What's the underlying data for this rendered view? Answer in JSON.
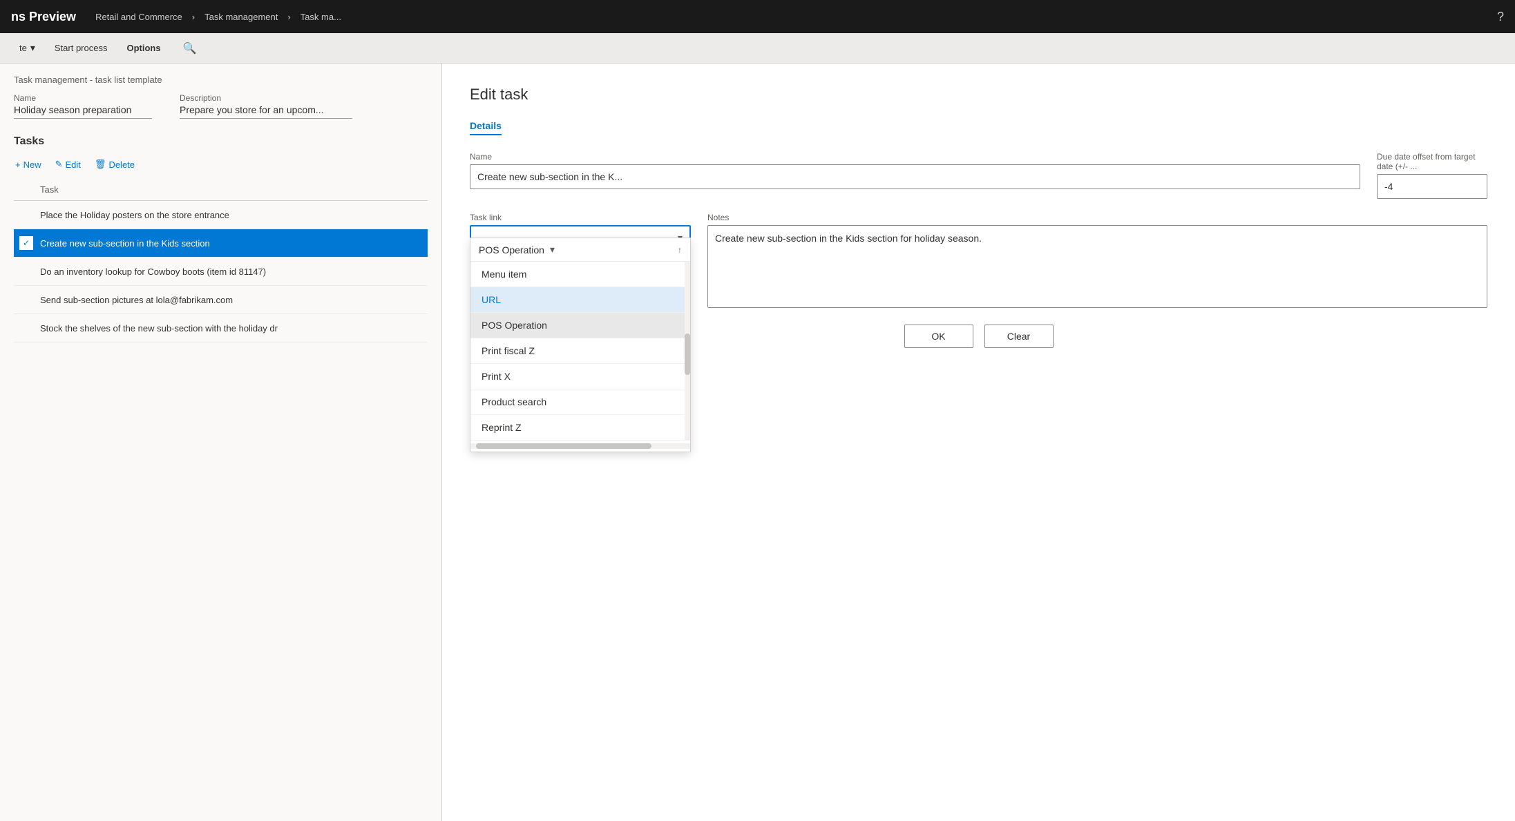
{
  "topNav": {
    "appTitle": "ns Preview",
    "breadcrumbs": [
      "Retail and Commerce",
      "Task management",
      "Task ma..."
    ],
    "helpIcon": "?"
  },
  "toolbar": {
    "deleteLabel": "te",
    "startProcessLabel": "Start process",
    "optionsLabel": "Options",
    "searchIcon": "🔍"
  },
  "leftPanel": {
    "pageTitle": "Task management - task list template",
    "nameLabel": "Name",
    "descriptionLabel": "Description",
    "nameValue": "Holiday season preparation",
    "descriptionValue": "Prepare you store for an upcom...",
    "tasksTitle": "Tasks",
    "newLabel": "+ New",
    "editLabel": "✎ Edit",
    "deleteLabel": "🗑 Delete",
    "taskColHeader": "Task",
    "tasks": [
      {
        "id": 1,
        "text": "Place the Holiday posters on the store entrance",
        "checked": false,
        "selected": false
      },
      {
        "id": 2,
        "text": "Create new sub-section in the Kids section",
        "checked": true,
        "selected": true
      },
      {
        "id": 3,
        "text": "Do an inventory lookup for Cowboy boots (item id 81147)",
        "checked": false,
        "selected": false
      },
      {
        "id": 4,
        "text": "Send sub-section pictures at lola@fabrikam.com",
        "checked": false,
        "selected": false
      },
      {
        "id": 5,
        "text": "Stock the shelves of the new sub-section with the holiday dr",
        "checked": false,
        "selected": false
      }
    ]
  },
  "editTask": {
    "title": "Edit task",
    "detailsTabLabel": "Details",
    "nameLabel": "Name",
    "nameValue": "Create new sub-section in the K...",
    "dueDateLabel": "Due date offset from target date (+/- ...",
    "dueDateValue": "-4",
    "taskLinkLabel": "Task link",
    "taskLinkValue": "",
    "notesLabel": "Notes",
    "notesValue": "Create new sub-section in the Kids section for holiday season.",
    "dropdown": {
      "selectedLabel": "POS Operation",
      "options": [
        {
          "id": "menu-item",
          "label": "Menu item",
          "state": "normal"
        },
        {
          "id": "url",
          "label": "URL",
          "state": "highlighted"
        },
        {
          "id": "pos-operation",
          "label": "POS Operation",
          "state": "selected"
        },
        {
          "id": "print-fiscal-z",
          "label": "Print fiscal Z",
          "state": "normal"
        },
        {
          "id": "print-x",
          "label": "Print X",
          "state": "normal"
        },
        {
          "id": "product-search",
          "label": "Product search",
          "state": "normal"
        },
        {
          "id": "reprint-z",
          "label": "Reprint Z",
          "state": "normal"
        }
      ]
    },
    "okLabel": "OK",
    "clearLabel": "Clear"
  }
}
